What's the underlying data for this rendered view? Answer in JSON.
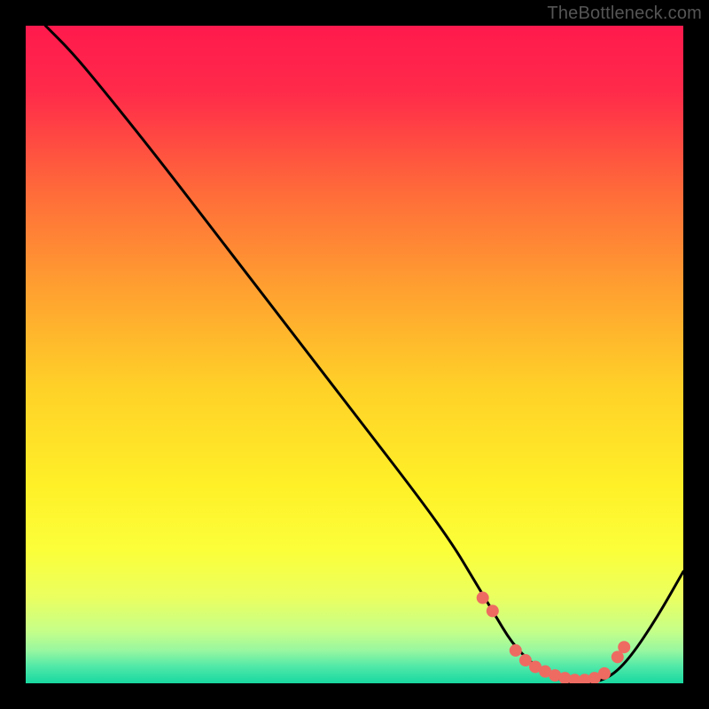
{
  "watermark": "TheBottleneck.com",
  "chart_data": {
    "type": "line",
    "title": "",
    "xlabel": "",
    "ylabel": "",
    "xlim": [
      0,
      100
    ],
    "ylim": [
      0,
      100
    ],
    "series": [
      {
        "name": "bottleneck-curve",
        "x": [
          3,
          7,
          12,
          20,
          30,
          40,
          50,
          60,
          65,
          68,
          71,
          74,
          77,
          80,
          83,
          86,
          89,
          92,
          96,
          100
        ],
        "y": [
          100,
          96,
          90,
          80,
          67,
          54,
          41,
          28,
          21,
          16,
          11,
          6,
          3,
          1,
          0,
          0,
          1,
          4,
          10,
          17
        ]
      }
    ],
    "markers": {
      "name": "highlight-dots",
      "x": [
        69.5,
        71,
        74.5,
        76,
        77.5,
        79,
        80.5,
        82,
        83.5,
        85,
        86.5,
        88,
        90,
        91
      ],
      "y": [
        13,
        11,
        5,
        3.5,
        2.5,
        1.8,
        1.2,
        0.8,
        0.5,
        0.5,
        0.8,
        1.5,
        4,
        5.5
      ]
    },
    "gradient_stops": [
      {
        "offset": 0.0,
        "color": "#ff1a4d"
      },
      {
        "offset": 0.1,
        "color": "#ff2a4a"
      },
      {
        "offset": 0.25,
        "color": "#ff6a3a"
      },
      {
        "offset": 0.4,
        "color": "#ffa030"
      },
      {
        "offset": 0.55,
        "color": "#ffd128"
      },
      {
        "offset": 0.7,
        "color": "#fff028"
      },
      {
        "offset": 0.8,
        "color": "#fbff3a"
      },
      {
        "offset": 0.87,
        "color": "#eaff60"
      },
      {
        "offset": 0.92,
        "color": "#c6ff88"
      },
      {
        "offset": 0.95,
        "color": "#98f7a0"
      },
      {
        "offset": 0.975,
        "color": "#4fe8a8"
      },
      {
        "offset": 1.0,
        "color": "#18d8a0"
      }
    ]
  }
}
